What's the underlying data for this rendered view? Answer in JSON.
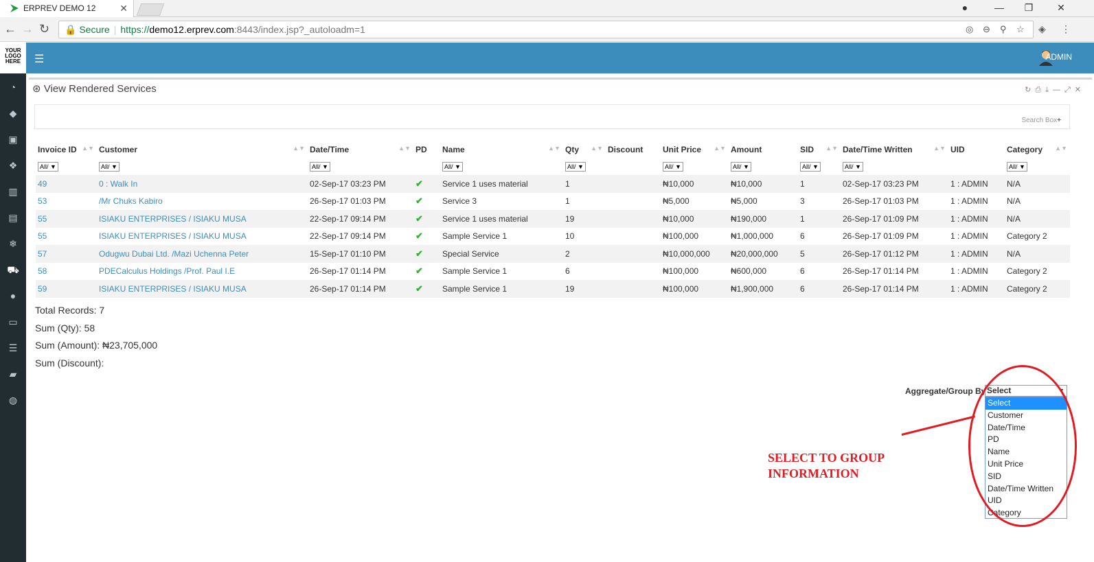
{
  "browser": {
    "tab_title": "ERPREV DEMO 12",
    "secure_label": "Secure",
    "url_scheme": "https://",
    "url_host": "demo12.erprev.com",
    "url_rest": ":8443/index.jsp?_autoloadm=1"
  },
  "app": {
    "logo_text": [
      "YOUR",
      "LOGO",
      "HERE"
    ],
    "user": "ADMIN",
    "accent_color": "#3c8dbc",
    "sidebar_color": "#222d32"
  },
  "panel": {
    "title": "View Rendered Services",
    "search_label": "Search Box"
  },
  "table": {
    "columns": [
      "Invoice ID",
      "Customer",
      "Date/Time",
      "PD",
      "Name",
      "Qty",
      "Discount",
      "Unit Price",
      "Amount",
      "SID",
      "Date/Time Written",
      "UID",
      "Category"
    ],
    "filter_value": "All/",
    "rows": [
      {
        "invoice": "49",
        "customer": "0 : Walk In",
        "datetime": "02-Sep-17 03:23 PM",
        "pd": "✔",
        "name": "Service 1 uses material",
        "qty": "1",
        "discount": "",
        "unit_price": "₦10,000",
        "amount": "₦10,000",
        "sid": "1",
        "written": "02-Sep-17 03:23 PM",
        "uid": "1 : ADMIN",
        "category": "N/A"
      },
      {
        "invoice": "53",
        "customer": "/Mr Chuks Kabiro",
        "datetime": "26-Sep-17 01:03 PM",
        "pd": "✔",
        "name": "Service 3",
        "qty": "1",
        "discount": "",
        "unit_price": "₦5,000",
        "amount": "₦5,000",
        "sid": "3",
        "written": "26-Sep-17 01:03 PM",
        "uid": "1 : ADMIN",
        "category": "N/A"
      },
      {
        "invoice": "55",
        "customer": "ISIAKU ENTERPRISES / ISIAKU MUSA",
        "datetime": "22-Sep-17 09:14 PM",
        "pd": "✔",
        "name": "Service 1 uses material",
        "qty": "19",
        "discount": "",
        "unit_price": "₦10,000",
        "amount": "₦190,000",
        "sid": "1",
        "written": "26-Sep-17 01:09 PM",
        "uid": "1 : ADMIN",
        "category": "N/A"
      },
      {
        "invoice": "55",
        "customer": "ISIAKU ENTERPRISES / ISIAKU MUSA",
        "datetime": "22-Sep-17 09:14 PM",
        "pd": "✔",
        "name": "Sample Service 1",
        "qty": "10",
        "discount": "",
        "unit_price": "₦100,000",
        "amount": "₦1,000,000",
        "sid": "6",
        "written": "26-Sep-17 01:09 PM",
        "uid": "1 : ADMIN",
        "category": "Category 2"
      },
      {
        "invoice": "57",
        "customer": "Odugwu Dubai Ltd. /Mazi Uchenna Peter",
        "datetime": "15-Sep-17 01:10 PM",
        "pd": "✔",
        "name": "Special Service",
        "qty": "2",
        "discount": "",
        "unit_price": "₦10,000,000",
        "amount": "₦20,000,000",
        "sid": "5",
        "written": "26-Sep-17 01:12 PM",
        "uid": "1 : ADMIN",
        "category": "N/A"
      },
      {
        "invoice": "58",
        "customer": "PDECalculus Holdings /Prof. Paul I.E",
        "datetime": "26-Sep-17 01:14 PM",
        "pd": "✔",
        "name": "Sample Service 1",
        "qty": "6",
        "discount": "",
        "unit_price": "₦100,000",
        "amount": "₦600,000",
        "sid": "6",
        "written": "26-Sep-17 01:14 PM",
        "uid": "1 : ADMIN",
        "category": "Category 2"
      },
      {
        "invoice": "59",
        "customer": "ISIAKU ENTERPRISES / ISIAKU MUSA",
        "datetime": "26-Sep-17 01:14 PM",
        "pd": "✔",
        "name": "Sample Service 1",
        "qty": "19",
        "discount": "",
        "unit_price": "₦100,000",
        "amount": "₦1,900,000",
        "sid": "6",
        "written": "26-Sep-17 01:14 PM",
        "uid": "1 : ADMIN",
        "category": "Category 2"
      }
    ]
  },
  "totals": {
    "records": "Total Records: 7",
    "qty": "Sum (Qty): 58",
    "amount": "Sum (Amount): ₦23,705,000",
    "discount": "Sum (Discount):"
  },
  "aggregate": {
    "label": "Aggregate/Group By:",
    "selected": "Select",
    "options": [
      "Select",
      "Customer",
      "Date/Time",
      "PD",
      "Name",
      "Unit Price",
      "SID",
      "Date/Time Written",
      "UID",
      "Category"
    ]
  },
  "annotation": {
    "line1": "SELECT TO GROUP",
    "line2": "INFORMATION",
    "color": "#e21b23"
  }
}
